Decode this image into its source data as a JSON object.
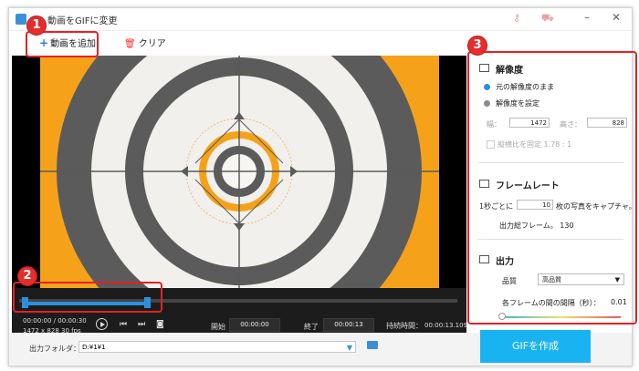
{
  "window": {
    "title": "動画をGIFに変更"
  },
  "toolbar": {
    "add_video": "動画を追加",
    "clear": "クリア"
  },
  "player": {
    "time": "00:00:00 / 00:00:30",
    "resolution_fps": "1472 x 828    30 fps",
    "start_label": "開始",
    "start_value": "00:00:00",
    "end_label": "終了",
    "end_value": "00:00:13",
    "duration_label": "持続時間：",
    "duration_value": "00:00:13.109"
  },
  "output": {
    "folder_label": "出力フォルダ：",
    "folder_path": "D:¥1¥1",
    "create_button": "GIFを作成"
  },
  "settings": {
    "resolution": {
      "title": "解像度",
      "keep_original": "元の解像度のまま",
      "custom": "解像度を設定",
      "width_label": "幅：",
      "width_value": "1472",
      "height_label": "高さ：",
      "height_value": "828",
      "lock_ratio": "縦横比を固定  1.78 : 1"
    },
    "framerate": {
      "title": "フレームレート",
      "capture_prefix": "1秒ごとに",
      "capture_value": "10",
      "capture_suffix": "枚の写真をキャプチャ。",
      "total_frames": "出力総フレーム。  130"
    },
    "output": {
      "title": "出力",
      "quality_label": "品質",
      "quality_value": "高品質",
      "interval_label": "各フレームの間の間隔（秒）：",
      "interval_value": "0.01",
      "interval_level": 0
    }
  },
  "annotations": {
    "badge1": "1",
    "badge2": "2",
    "badge3": "3"
  },
  "colors": {
    "accent": "#1ab3f2",
    "highlight": "#e52222",
    "frame_orange": "#f5a21a"
  }
}
